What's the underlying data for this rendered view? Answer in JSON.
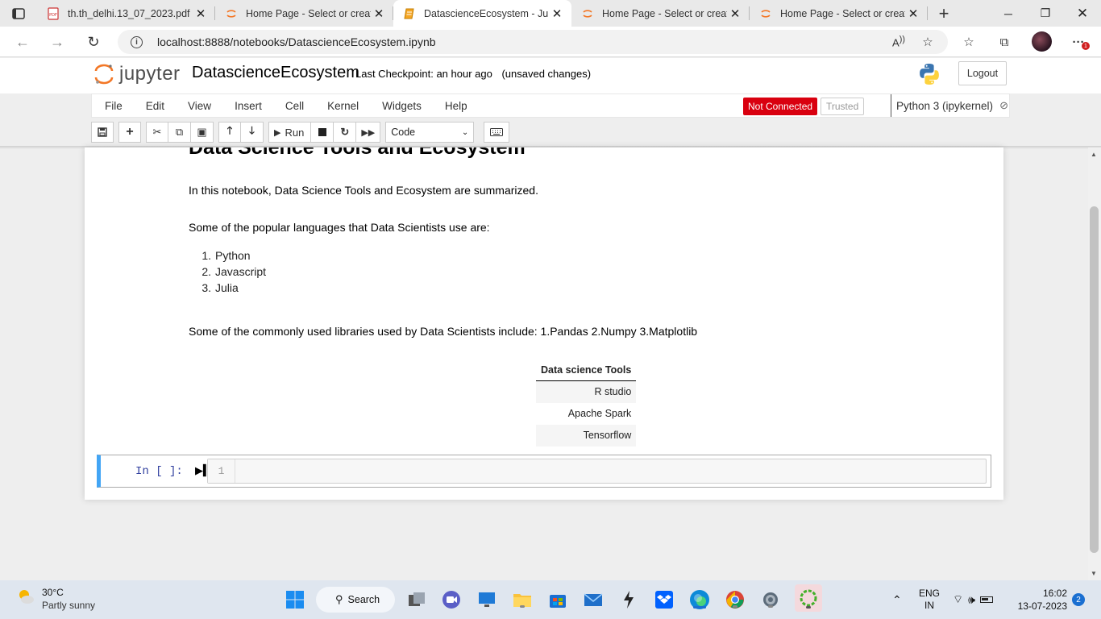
{
  "browser": {
    "tabs": [
      {
        "title": "th.th_delhi.13_07_2023.pdf",
        "icon": "pdf-icon",
        "active": false
      },
      {
        "title": "Home Page - Select or create",
        "icon": "jupyter-icon",
        "active": false
      },
      {
        "title": "DatascienceEcosystem - Jupy",
        "icon": "notebook-icon",
        "active": true
      },
      {
        "title": "Home Page - Select or create",
        "icon": "jupyter-icon",
        "active": false
      },
      {
        "title": "Home Page - Select or create",
        "icon": "jupyter-icon",
        "active": false
      }
    ],
    "address": "localhost:8888/notebooks/DatascienceEcosystem.ipynb",
    "extension_badge": "1"
  },
  "jupyter": {
    "logo_text": "jupyter",
    "notebook_name": "DatascienceEcosystem",
    "checkpoint": "Last Checkpoint: an hour ago",
    "unsaved": "(unsaved changes)",
    "logout": "Logout",
    "menu": [
      "File",
      "Edit",
      "View",
      "Insert",
      "Cell",
      "Kernel",
      "Widgets",
      "Help"
    ],
    "status_not_connected": "Not Connected",
    "status_trusted": "Trusted",
    "kernel": "Python 3 (ipykernel)",
    "toolbar": {
      "run_label": "Run",
      "cell_type": "Code"
    }
  },
  "notebook": {
    "heading": "Data Science Tools and Ecosystem",
    "intro": "In this notebook, Data Science Tools and Ecosystem are summarized.",
    "languages_intro": "Some of the popular languages that Data Scientists use are:",
    "languages": [
      "Python",
      "Javascript",
      "Julia"
    ],
    "libraries": "Some of the commonly used libraries used by Data Scientists include: 1.Pandas 2.Numpy 3.Matplotlib",
    "table": {
      "header": "Data science Tools",
      "rows": [
        "R studio",
        "Apache Spark",
        "Tensorflow"
      ]
    },
    "code_cell": {
      "prompt": "In [ ]:",
      "line_number": "1",
      "content": ""
    }
  },
  "taskbar": {
    "temperature": "30°C",
    "condition": "Partly sunny",
    "search": "Search",
    "language": "ENG",
    "region": "IN",
    "time": "16:02",
    "date": "13-07-2023",
    "notifications": "2"
  },
  "colors": {
    "jupyter_orange": "#f37726",
    "not_connected_red": "#d9000f",
    "cell_selected_blue": "#42a5f5",
    "prompt_blue": "#303f9f"
  }
}
